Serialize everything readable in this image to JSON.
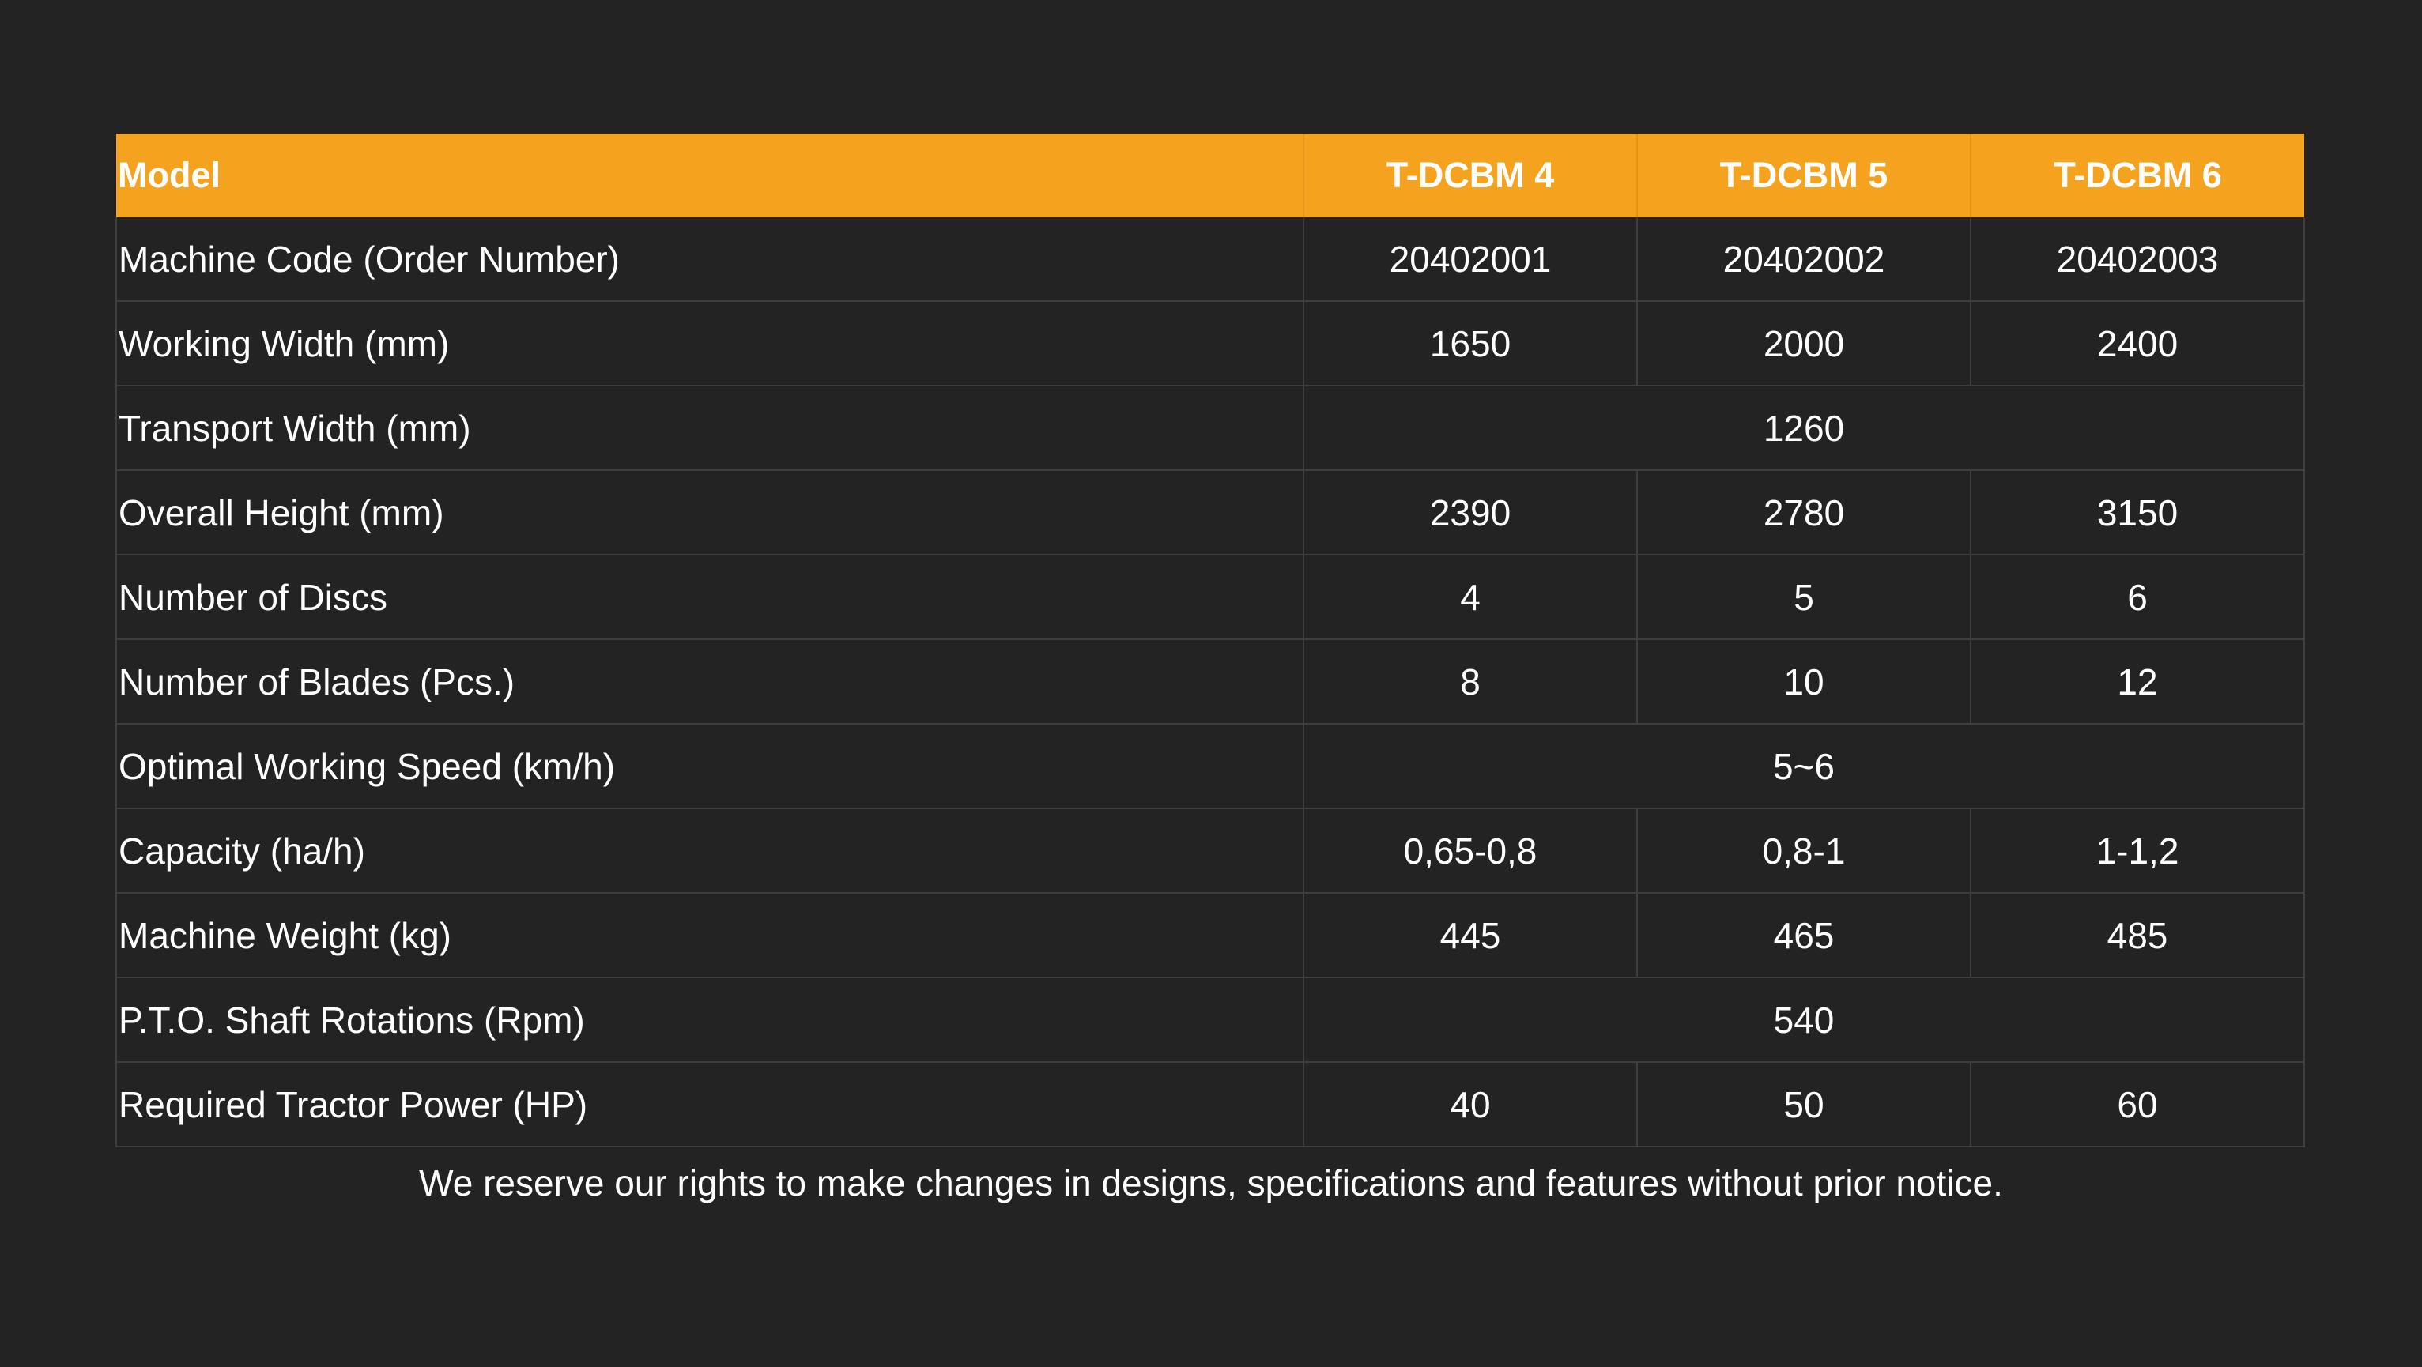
{
  "table": {
    "header": {
      "label": "Model",
      "models": [
        "T-DCBM 4",
        "T-DCBM 5",
        "T-DCBM 6"
      ]
    },
    "rows": [
      {
        "label": "Machine Code (Order Number)",
        "values": [
          "20402001",
          "20402002",
          "20402003"
        ]
      },
      {
        "label": "Working Width (mm)",
        "values": [
          "1650",
          "2000",
          "2400"
        ]
      },
      {
        "label": "Transport Width (mm)",
        "shared": "1260"
      },
      {
        "label": "Overall Height (mm)",
        "values": [
          "2390",
          "2780",
          "3150"
        ]
      },
      {
        "label": "Number of Discs",
        "values": [
          "4",
          "5",
          "6"
        ]
      },
      {
        "label": "Number of Blades (Pcs.)",
        "values": [
          "8",
          "10",
          "12"
        ]
      },
      {
        "label": "Optimal Working Speed (km/h)",
        "shared": "5~6"
      },
      {
        "label": "Capacity (ha/h)",
        "values": [
          "0,65-0,8",
          "0,8-1",
          "1-1,2"
        ]
      },
      {
        "label": "Machine Weight (kg)",
        "values": [
          "445",
          "465",
          "485"
        ]
      },
      {
        "label": "P.T.O. Shaft Rotations (Rpm)",
        "shared": "540"
      },
      {
        "label": "Required Tractor Power (HP)",
        "values": [
          "40",
          "50",
          "60"
        ]
      }
    ]
  },
  "notice": "We reserve our rights to make changes in designs, specifications and features without prior notice.",
  "colors": {
    "background": "#232323",
    "header_accent": "#f5a31f",
    "grid_line": "#3e3e3e",
    "text": "#ffffff"
  }
}
